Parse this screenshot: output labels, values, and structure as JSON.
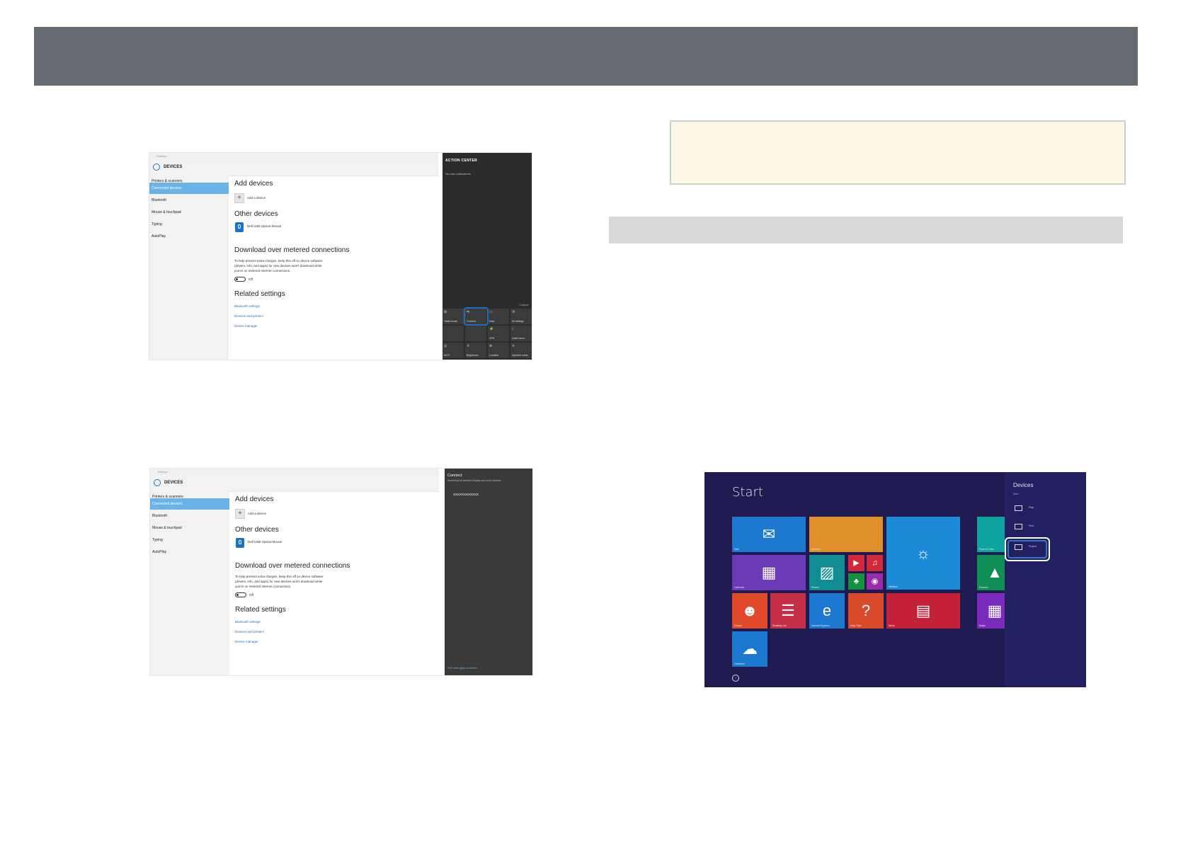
{
  "colors": {
    "header_bar": "#666a71",
    "note_background": "#fdf8ea",
    "section_bar": "#d9d9d9",
    "win10_accent": "#1a73c8",
    "win8_background": "#1f1a4f"
  },
  "screenshot_action_center": {
    "titlebar": "Settings",
    "header_title": "DEVICES",
    "sidebar": [
      "Printers & scanners",
      "Connected devices",
      "Bluetooth",
      "Mouse & touchpad",
      "Typing",
      "AutoPlay"
    ],
    "add_devices_heading": "Add devices",
    "add_device_label": "Add a device",
    "other_devices_heading": "Other devices",
    "device_name": "Dell USB Optical Mouse",
    "download_heading": "Download over metered connections",
    "download_text": [
      "To help prevent extra charges, keep this off so device software",
      "(drivers, info, and apps) for new devices won't download while",
      "you're on metered Internet connections."
    ],
    "toggle_label": "Off",
    "related_heading": "Related settings",
    "related_links": [
      "Bluetooth settings",
      "Devices and printers",
      "Device manager"
    ],
    "action_center": {
      "title": "ACTION CENTER",
      "subtitle": "No new notifications",
      "collapse": "Collapse",
      "tiles": [
        {
          "icon": "⊞",
          "label": "Tablet mode"
        },
        {
          "icon": "⇆",
          "label": "Connect"
        },
        {
          "icon": "▭",
          "label": "Note"
        },
        {
          "icon": "⚙",
          "label": "All settings"
        },
        {
          "icon": "",
          "label": ""
        },
        {
          "icon": "",
          "label": ""
        },
        {
          "icon": "⚡",
          "label": "VPN"
        },
        {
          "icon": "☾",
          "label": "Quiet hours"
        },
        {
          "icon": "◎",
          "label": "Wi-Fi"
        },
        {
          "icon": "☀",
          "label": "Brightness"
        },
        {
          "icon": "⊕",
          "label": "Location"
        },
        {
          "icon": "✈",
          "label": "Airplane mode"
        }
      ]
    }
  },
  "screenshot_connect": {
    "titlebar": "Settings",
    "header_title": "DEVICES",
    "sidebar": [
      "Printers & scanners",
      "Connected devices",
      "Bluetooth",
      "Mouse & touchpad",
      "Typing",
      "AutoPlay"
    ],
    "add_devices_heading": "Add devices",
    "add_device_label": "Add a device",
    "other_devices_heading": "Other devices",
    "device_name": "Dell USB Optical Mouse",
    "download_heading": "Download over metered connections",
    "download_text": [
      "To help prevent extra charges, keep this off so device software",
      "(drivers, info, and apps) for new devices won't download while",
      "you're on metered Internet connections."
    ],
    "toggle_label": "Off",
    "related_heading": "Related settings",
    "related_links": [
      "Bluetooth settings",
      "Devices and printers",
      "Device manager"
    ],
    "connect_panel": {
      "title": "Connect",
      "subtitle": "Searching for wireless display and audio devices",
      "device": "XXXXXXXXXXXX",
      "bottom_link": "Find other types of devices"
    }
  },
  "screenshot_start": {
    "title": "Start",
    "tiles": [
      {
        "label": "Mail",
        "glyph": "✉",
        "color": "#1d79cf"
      },
      {
        "label": "Desktop",
        "glyph": "",
        "color": "#e0902a"
      },
      {
        "label": "Weather",
        "glyph": "☼",
        "color": "#1d8ad8"
      },
      {
        "label": "Calendar",
        "glyph": "▦",
        "color": "#6a3ab7"
      },
      {
        "label": "Photos",
        "glyph": "▨",
        "color": "#0f8d92"
      },
      {
        "label": "Video",
        "glyph": "▶",
        "color": "#d2283a"
      },
      {
        "label": "Music",
        "glyph": "♫",
        "color": "#d2283a"
      },
      {
        "label": "Games",
        "glyph": "♣",
        "color": "#14913c"
      },
      {
        "label": "Camera",
        "glyph": "◉",
        "color": "#9b2ba8"
      },
      {
        "label": "People",
        "glyph": "☻",
        "color": "#e04a2b"
      },
      {
        "label": "Reading List",
        "glyph": "☰",
        "color": "#c62f47"
      },
      {
        "label": "Internet Explorer",
        "glyph": "e",
        "color": "#1d79cf"
      },
      {
        "label": "Help+Tips",
        "glyph": "?",
        "color": "#d84a2a"
      },
      {
        "label": "News",
        "glyph": "▤",
        "color": "#c42038"
      },
      {
        "label": "OneDrive",
        "glyph": "☁",
        "color": "#1d79cf"
      },
      {
        "label": "Food & Drink",
        "glyph": "",
        "color": "#0fa3a0"
      },
      {
        "label": "Finance",
        "glyph": "▲",
        "color": "#0f8f55"
      },
      {
        "label": "Maps",
        "glyph": "▦",
        "color": "#7a2bbb"
      }
    ],
    "charm": {
      "title": "Devices",
      "subtitle": "Start",
      "items": [
        "Play",
        "Print",
        "Project"
      ]
    }
  }
}
